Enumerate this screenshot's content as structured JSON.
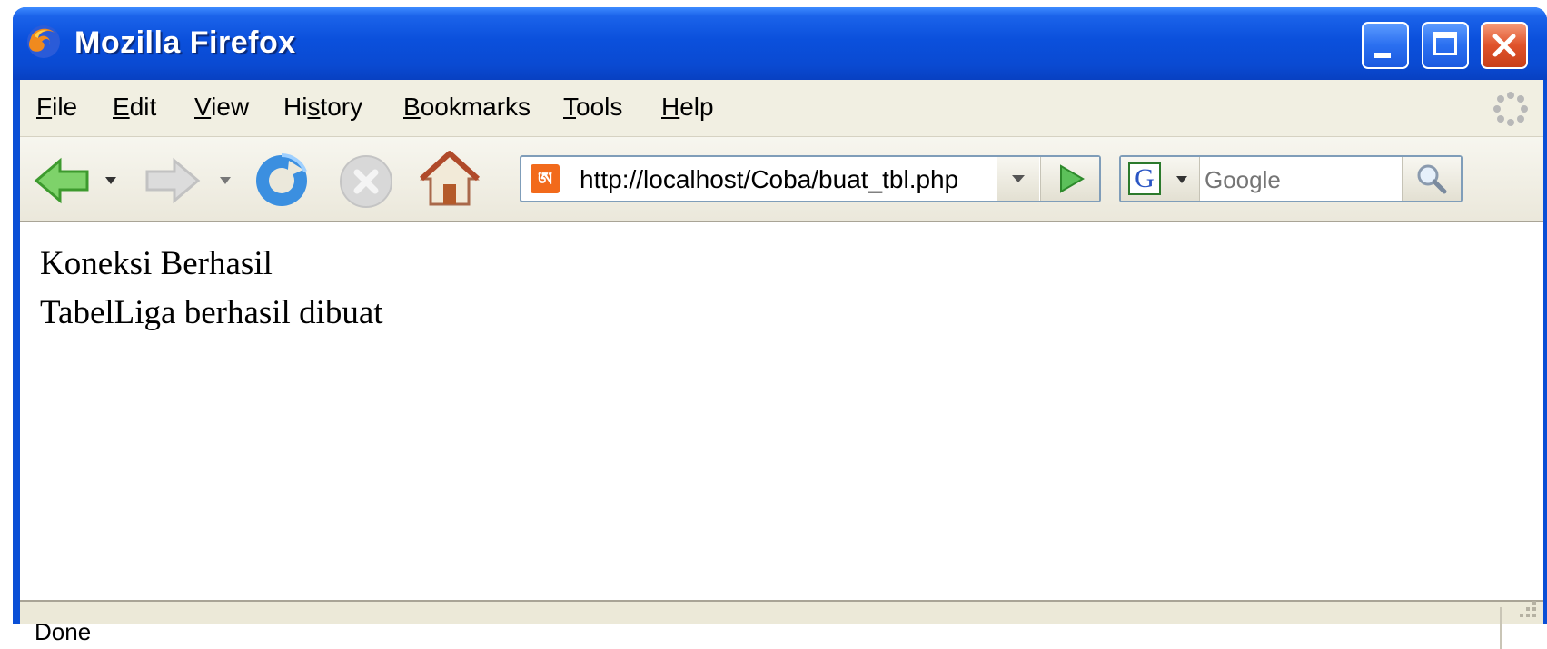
{
  "window": {
    "title": "Mozilla Firefox"
  },
  "menu": [
    {
      "key": "F",
      "rest": "ile"
    },
    {
      "key": "E",
      "rest": "dit"
    },
    {
      "key": "V",
      "rest": "iew"
    },
    {
      "pre": "Hi",
      "key": "s",
      "rest": "tory"
    },
    {
      "key": "B",
      "rest": "ookmarks"
    },
    {
      "key": "T",
      "rest": "ools"
    },
    {
      "key": "H",
      "rest": "elp"
    }
  ],
  "toolbar": {
    "url": "http://localhost/Coba/buat_tbl.php",
    "search_placeholder": "Google",
    "search_engine_letter": "G"
  },
  "content": {
    "lines": [
      "Koneksi Berhasil",
      "TabelLiga berhasil dibuat"
    ]
  },
  "status": {
    "text": "Done"
  },
  "colors": {
    "titlebar": "#0a4fd6",
    "accent_orange": "#f26a1b"
  }
}
